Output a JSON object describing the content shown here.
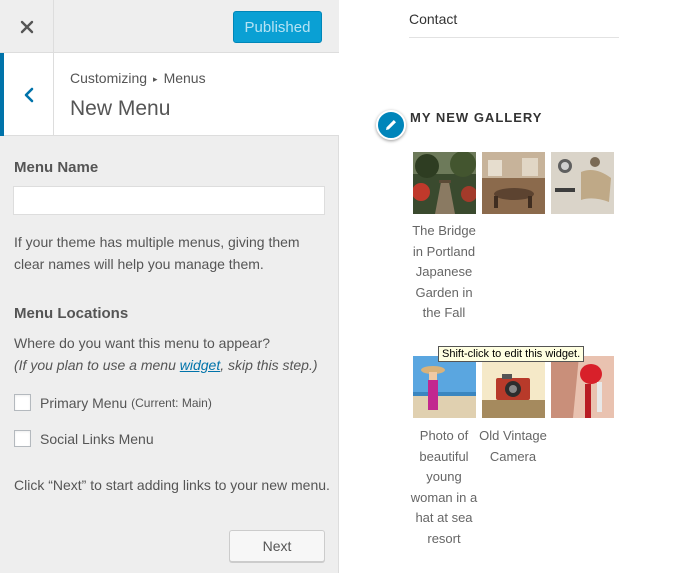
{
  "topbar": {
    "close_icon": "close-icon",
    "publish_label": "Published"
  },
  "section": {
    "breadcrumb_parent": "Customizing",
    "breadcrumb_separator": "▸",
    "breadcrumb_child": "Menus",
    "title": "New Menu",
    "back_icon": "chevron-left-icon"
  },
  "form": {
    "menu_name_label": "Menu Name",
    "menu_name_value": "",
    "menu_name_help": "If your theme has multiple menus, giving them clear names will help you manage them.",
    "locations_label": "Menu Locations",
    "locations_question": "Where do you want this menu to appear?",
    "locations_hint_before": "(If you plan to use a menu ",
    "locations_hint_link": "widget",
    "locations_hint_after": ", skip this step.)",
    "locations": [
      {
        "label": "Primary Menu",
        "note": "(Current: Main)",
        "checked": false
      },
      {
        "label": "Social Links Menu",
        "note": "",
        "checked": false
      }
    ],
    "next_help": "Click “Next” to start adding links to your new menu.",
    "next_label": "Next"
  },
  "preview": {
    "contact_link": "Contact",
    "edit_icon": "pencil-icon",
    "gallery_title": "MY NEW GALLERY",
    "captions": {
      "bridge": "The Bridge in Portland Japanese Garden in the Fall",
      "woman": "Photo of beautiful young woman in a hat at sea resort",
      "camera": "Old Vintage Camera"
    },
    "tooltip": "Shift-click to edit this widget."
  },
  "colors": {
    "accent": "#0073aa",
    "publish_bg": "#0aa0d4",
    "panel_bg": "#eeeeee"
  }
}
